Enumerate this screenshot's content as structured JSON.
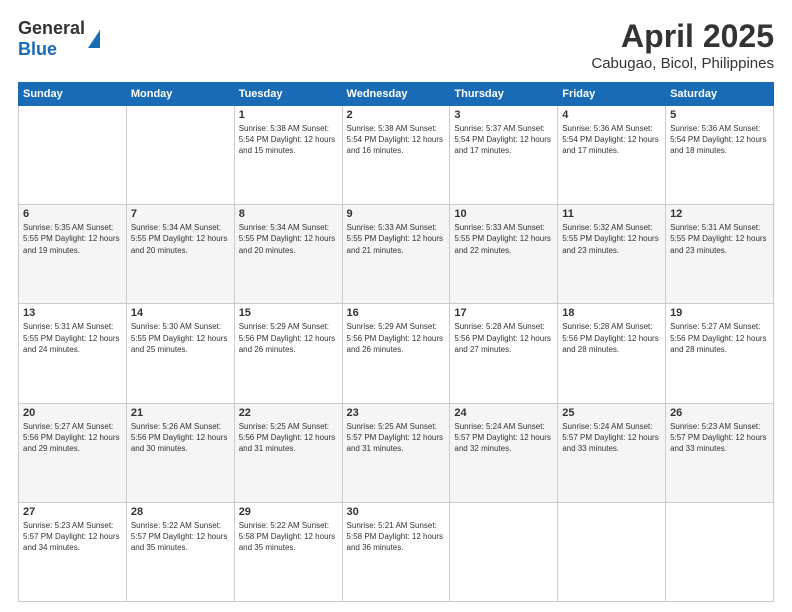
{
  "header": {
    "logo_general": "General",
    "logo_blue": "Blue",
    "month_title": "April 2025",
    "location": "Cabugao, Bicol, Philippines"
  },
  "days_of_week": [
    "Sunday",
    "Monday",
    "Tuesday",
    "Wednesday",
    "Thursday",
    "Friday",
    "Saturday"
  ],
  "weeks": [
    [
      {
        "day": "",
        "info": ""
      },
      {
        "day": "",
        "info": ""
      },
      {
        "day": "1",
        "info": "Sunrise: 5:38 AM\nSunset: 5:54 PM\nDaylight: 12 hours\nand 15 minutes."
      },
      {
        "day": "2",
        "info": "Sunrise: 5:38 AM\nSunset: 5:54 PM\nDaylight: 12 hours\nand 16 minutes."
      },
      {
        "day": "3",
        "info": "Sunrise: 5:37 AM\nSunset: 5:54 PM\nDaylight: 12 hours\nand 17 minutes."
      },
      {
        "day": "4",
        "info": "Sunrise: 5:36 AM\nSunset: 5:54 PM\nDaylight: 12 hours\nand 17 minutes."
      },
      {
        "day": "5",
        "info": "Sunrise: 5:36 AM\nSunset: 5:54 PM\nDaylight: 12 hours\nand 18 minutes."
      }
    ],
    [
      {
        "day": "6",
        "info": "Sunrise: 5:35 AM\nSunset: 5:55 PM\nDaylight: 12 hours\nand 19 minutes."
      },
      {
        "day": "7",
        "info": "Sunrise: 5:34 AM\nSunset: 5:55 PM\nDaylight: 12 hours\nand 20 minutes."
      },
      {
        "day": "8",
        "info": "Sunrise: 5:34 AM\nSunset: 5:55 PM\nDaylight: 12 hours\nand 20 minutes."
      },
      {
        "day": "9",
        "info": "Sunrise: 5:33 AM\nSunset: 5:55 PM\nDaylight: 12 hours\nand 21 minutes."
      },
      {
        "day": "10",
        "info": "Sunrise: 5:33 AM\nSunset: 5:55 PM\nDaylight: 12 hours\nand 22 minutes."
      },
      {
        "day": "11",
        "info": "Sunrise: 5:32 AM\nSunset: 5:55 PM\nDaylight: 12 hours\nand 23 minutes."
      },
      {
        "day": "12",
        "info": "Sunrise: 5:31 AM\nSunset: 5:55 PM\nDaylight: 12 hours\nand 23 minutes."
      }
    ],
    [
      {
        "day": "13",
        "info": "Sunrise: 5:31 AM\nSunset: 5:55 PM\nDaylight: 12 hours\nand 24 minutes."
      },
      {
        "day": "14",
        "info": "Sunrise: 5:30 AM\nSunset: 5:55 PM\nDaylight: 12 hours\nand 25 minutes."
      },
      {
        "day": "15",
        "info": "Sunrise: 5:29 AM\nSunset: 5:56 PM\nDaylight: 12 hours\nand 26 minutes."
      },
      {
        "day": "16",
        "info": "Sunrise: 5:29 AM\nSunset: 5:56 PM\nDaylight: 12 hours\nand 26 minutes."
      },
      {
        "day": "17",
        "info": "Sunrise: 5:28 AM\nSunset: 5:56 PM\nDaylight: 12 hours\nand 27 minutes."
      },
      {
        "day": "18",
        "info": "Sunrise: 5:28 AM\nSunset: 5:56 PM\nDaylight: 12 hours\nand 28 minutes."
      },
      {
        "day": "19",
        "info": "Sunrise: 5:27 AM\nSunset: 5:56 PM\nDaylight: 12 hours\nand 28 minutes."
      }
    ],
    [
      {
        "day": "20",
        "info": "Sunrise: 5:27 AM\nSunset: 5:56 PM\nDaylight: 12 hours\nand 29 minutes."
      },
      {
        "day": "21",
        "info": "Sunrise: 5:26 AM\nSunset: 5:56 PM\nDaylight: 12 hours\nand 30 minutes."
      },
      {
        "day": "22",
        "info": "Sunrise: 5:25 AM\nSunset: 5:56 PM\nDaylight: 12 hours\nand 31 minutes."
      },
      {
        "day": "23",
        "info": "Sunrise: 5:25 AM\nSunset: 5:57 PM\nDaylight: 12 hours\nand 31 minutes."
      },
      {
        "day": "24",
        "info": "Sunrise: 5:24 AM\nSunset: 5:57 PM\nDaylight: 12 hours\nand 32 minutes."
      },
      {
        "day": "25",
        "info": "Sunrise: 5:24 AM\nSunset: 5:57 PM\nDaylight: 12 hours\nand 33 minutes."
      },
      {
        "day": "26",
        "info": "Sunrise: 5:23 AM\nSunset: 5:57 PM\nDaylight: 12 hours\nand 33 minutes."
      }
    ],
    [
      {
        "day": "27",
        "info": "Sunrise: 5:23 AM\nSunset: 5:57 PM\nDaylight: 12 hours\nand 34 minutes."
      },
      {
        "day": "28",
        "info": "Sunrise: 5:22 AM\nSunset: 5:57 PM\nDaylight: 12 hours\nand 35 minutes."
      },
      {
        "day": "29",
        "info": "Sunrise: 5:22 AM\nSunset: 5:58 PM\nDaylight: 12 hours\nand 35 minutes."
      },
      {
        "day": "30",
        "info": "Sunrise: 5:21 AM\nSunset: 5:58 PM\nDaylight: 12 hours\nand 36 minutes."
      },
      {
        "day": "",
        "info": ""
      },
      {
        "day": "",
        "info": ""
      },
      {
        "day": "",
        "info": ""
      }
    ]
  ]
}
